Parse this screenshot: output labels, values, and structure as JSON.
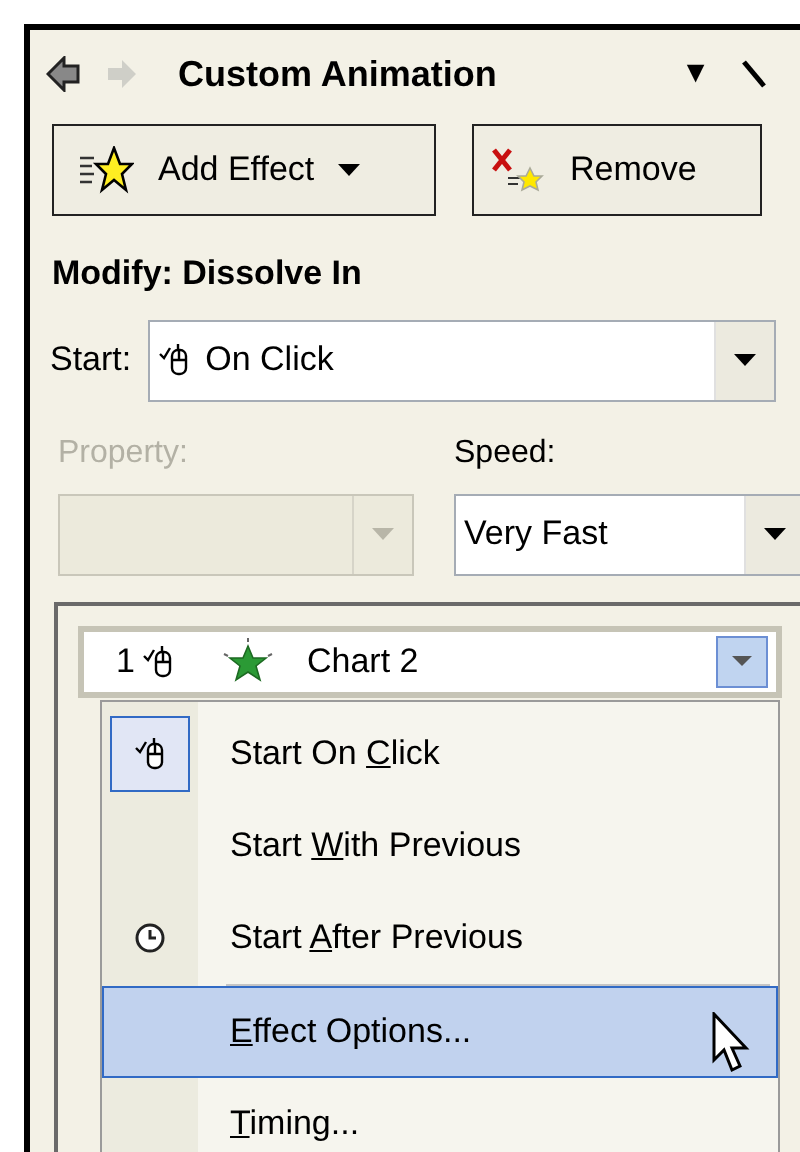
{
  "pane": {
    "title": "Custom Animation",
    "menu_glyph": "▼",
    "back_disabled": false,
    "forward_disabled": true
  },
  "toolbar": [
    {
      "label": "Add Effect",
      "kind": "add",
      "dropdown": true
    },
    {
      "label": "Remove",
      "kind": "remove",
      "dropdown": false
    }
  ],
  "modify_heading": "Modify: Dissolve In",
  "start": {
    "label": "Start:",
    "value": "On Click",
    "disabled": false
  },
  "property": {
    "label": "Property:",
    "disabled": true
  },
  "speed": {
    "label": "Speed:",
    "value": "Very Fast",
    "disabled": false
  },
  "effect_item": {
    "number": "1",
    "name": "Chart 2",
    "selected": true
  },
  "context_menu": [
    {
      "pre": "Start On ",
      "key": "C",
      "post": "lick",
      "kind": "mouse",
      "checked": true,
      "selected": false
    },
    {
      "pre": "Start ",
      "key": "W",
      "post": "ith Previous",
      "kind": "none",
      "checked": false,
      "selected": false
    },
    {
      "pre": "Start ",
      "key": "A",
      "post": "fter Previous",
      "kind": "clock",
      "checked": false,
      "selected": false
    },
    {
      "key": "E",
      "post": "ffect Options...",
      "kind": "none",
      "checked": false,
      "selected": true,
      "separator_before": true
    },
    {
      "key": "T",
      "post": "iming...",
      "kind": "none",
      "checked": false,
      "selected": false
    }
  ]
}
